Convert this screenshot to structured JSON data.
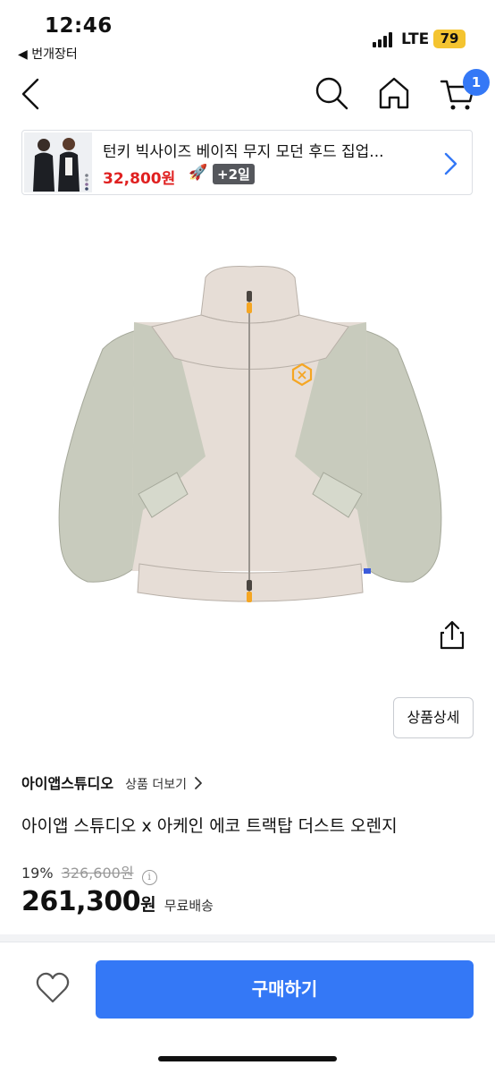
{
  "status_bar": {
    "time": "12:46",
    "carrier": "LTE",
    "battery": "79",
    "back_app": "◀ 번개장터"
  },
  "nav": {
    "cart_count": "1"
  },
  "banner": {
    "title": "턴키 빅사이즈 베이직 무지 모던 후드 집업...",
    "price": "32,800원",
    "rocket": "🚀",
    "delivery_days": "+2일"
  },
  "product": {
    "detail_button": "상품상세",
    "brand": "아이앱스튜디오",
    "brand_more": "상품 더보기",
    "name": "아이앱 스튜디오 x 아케인 에코 트랙탑 더스트 오렌지",
    "discount_rate": "19%",
    "original_price": "326,600원",
    "sale_price": "261,300",
    "price_unit": "원",
    "shipping": "무료배송"
  },
  "bottom": {
    "buy_label": "구매하기"
  },
  "colors": {
    "accent": "#3478f6",
    "price_red": "#e02020",
    "battery": "#f4c430",
    "jacket_body": "#e6ddd6",
    "jacket_sleeve": "#c8cbbd",
    "logo_orange": "#f5a623"
  },
  "icons": [
    "chevron-left-icon",
    "search-icon",
    "home-icon",
    "cart-icon",
    "chevron-right-icon",
    "share-icon",
    "info-icon",
    "heart-icon"
  ]
}
